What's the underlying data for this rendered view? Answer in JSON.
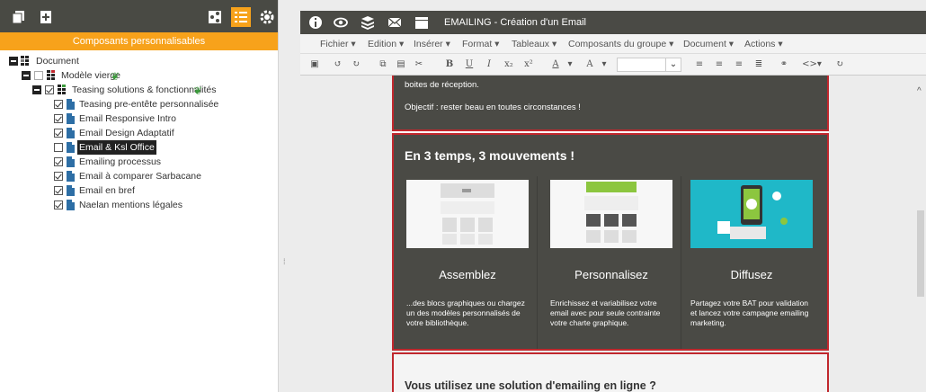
{
  "left_panel": {
    "header": "Composants personnalisables",
    "tree": {
      "root": "Document",
      "level1": "Modèle vierge",
      "level2": "Teasing solutions & fonctionnalités",
      "items": [
        {
          "label": "Teasing pre-entête personnalisée",
          "checked": true
        },
        {
          "label": "Email Responsive Intro",
          "checked": true
        },
        {
          "label": "Email Design Adaptatif",
          "checked": true
        },
        {
          "label": "Email & Ksl Office",
          "checked": false,
          "selected": true
        },
        {
          "label": "Emailing processus",
          "checked": true
        },
        {
          "label": "Email à comparer Sarbacane",
          "checked": true
        },
        {
          "label": "Email en bref",
          "checked": true
        },
        {
          "label": "Naelan mentions légales",
          "checked": true
        }
      ]
    }
  },
  "topbar": {
    "title": "EMAILING - Création d'un Email",
    "icons": [
      "info-icon",
      "eye-icon",
      "layers-icon",
      "envelope-icon",
      "folder-icon"
    ]
  },
  "menubar": {
    "items": [
      "Fichier",
      "Edition",
      "Insérer",
      "Format",
      "Tableaux",
      "Composants du groupe",
      "Document",
      "Actions"
    ]
  },
  "toolbar": {
    "buttons": [
      "B",
      "U",
      "I",
      "x₂",
      "x²",
      "A",
      "A"
    ]
  },
  "email": {
    "block1_line1": "boites de réception.",
    "block1_line2": "Objectif : rester beau en toutes circonstances !",
    "block2_title": "En 3 temps, 3 mouvements  !",
    "columns": [
      {
        "heading": "Assemblez",
        "text": "...des blocs graphiques ou chargez  un des modèles personnalisés de votre bibliothèque."
      },
      {
        "heading": "Personnalisez",
        "text": "Enrichissez et variabilisez votre email avec pour seule contrainte votre charte graphique."
      },
      {
        "heading": "Diffusez",
        "text": "Partagez votre BAT pour validation et lancez votre campagne emailing marketing."
      }
    ],
    "block3_title": "Vous utilisez une solution d'emailing en ligne ?"
  },
  "colors": {
    "dark": "#4a4a45",
    "accent": "#f7a21b",
    "frame_red": "#c0272d",
    "teal": "#1fb8c8",
    "green": "#8cc63f"
  }
}
